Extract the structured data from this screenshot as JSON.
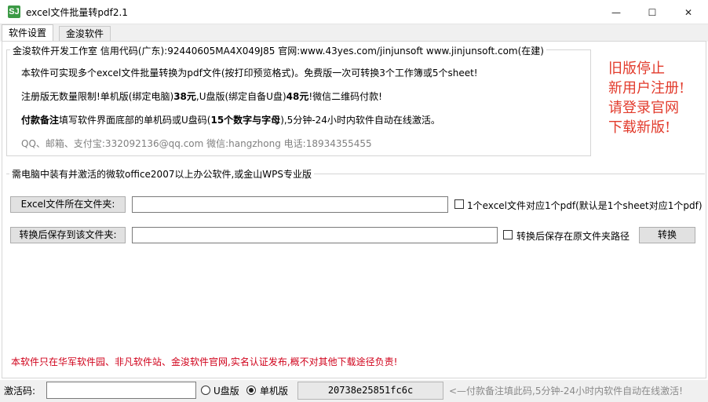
{
  "window": {
    "title": "excel文件批量转pdf2.1",
    "icon_glyph": "SJ",
    "controls": {
      "minimize": "—",
      "maximize": "☐",
      "close": "✕"
    }
  },
  "tabs": [
    {
      "label": "软件设置",
      "active": true
    },
    {
      "label": "金浚软件",
      "active": false
    }
  ],
  "info_group": {
    "legend": "金浚软件开发工作室 信用代码(广东):92440605MA4X049J85 官网:www.43yes.com/jinjunsoft  www.jinjunsoft.com(在建)",
    "line1": "本软件可实现多个excel文件批量转换为pdf文件(按打印预览格式)。免费版一次可转换3个工作簿或5个sheet!",
    "line2_a": "注册版无数量限制!单机版(绑定电脑)",
    "line2_b": "38元",
    "line2_c": ",U盘版(绑定自备U盘)",
    "line2_d": "48元",
    "line2_e": "!微信二维码付款!",
    "line3_a": "付款备注",
    "line3_b": "填写软件界面底部的单机码或U盘码(",
    "line3_c": "15个数字与字母",
    "line3_d": "),5分钟-24小时内软件自动在线激活。",
    "contact": "QQ、邮箱、支付宝:332092136@qq.com   微信:hangzhong   电话:18934355455"
  },
  "notice": {
    "lines": [
      "旧版停止",
      "新用户注册!",
      "请登录官网",
      "下载新版!"
    ],
    "color": "#e23b2c"
  },
  "convert_group": {
    "legend": "需电脑中装有并激活的微软office2007以上办公软件,或金山WPS专业版",
    "source_button": "Excel文件所在文件夹:",
    "source_value": "",
    "option1_label": "1个excel文件对应1个pdf(默认是1个sheet对应1个pdf)",
    "option1_checked": false,
    "target_button": "转换后保存到该文件夹:",
    "target_value": "",
    "option2_label": "转换后保存在原文件夹路径",
    "option2_checked": false,
    "convert_button": "转换"
  },
  "warning": "本软件只在华军软件园、非凡软件站、金浚软件官网,实名认证发布,概不对其他下载途径负责!",
  "status": {
    "code_label": "激活码:",
    "code_value": "",
    "radio_usb": "U盘版",
    "radio_pc": "单机版",
    "selected": "单机版",
    "machine_code": "20738e25851fc6c",
    "hint": "<—付款备注填此码,5分钟-24小时内软件自动在线激活!"
  }
}
